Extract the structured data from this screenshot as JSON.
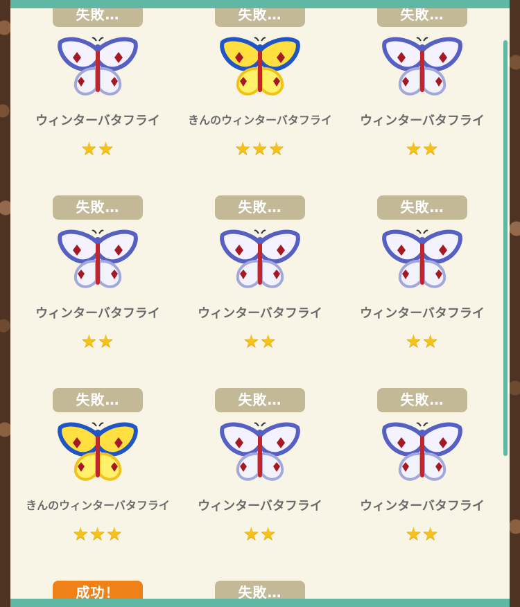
{
  "colors": {
    "panel_bg": "#f8f4e6",
    "accent_bar": "#5fb7a4",
    "fail_badge": "#c3b996",
    "success_badge": "#f08018",
    "star": "#f5c21b",
    "name_text": "#6a6a6a"
  },
  "results": [
    {
      "status": "失敗…",
      "name": "ウィンターバタフライ",
      "stars": "★★",
      "variant": "silver"
    },
    {
      "status": "失敗…",
      "name": "きんのウィンターバタフライ",
      "stars": "★★★",
      "variant": "gold"
    },
    {
      "status": "失敗…",
      "name": "ウィンターバタフライ",
      "stars": "★★",
      "variant": "silver"
    },
    {
      "status": "失敗…",
      "name": "ウィンターバタフライ",
      "stars": "★★",
      "variant": "silver"
    },
    {
      "status": "失敗…",
      "name": "ウィンターバタフライ",
      "stars": "★★",
      "variant": "silver"
    },
    {
      "status": "失敗…",
      "name": "ウィンターバタフライ",
      "stars": "★★",
      "variant": "silver"
    },
    {
      "status": "失敗…",
      "name": "きんのウィンターバタフライ",
      "stars": "★★★",
      "variant": "gold"
    },
    {
      "status": "失敗…",
      "name": "ウィンターバタフライ",
      "stars": "★★",
      "variant": "silver"
    },
    {
      "status": "失敗…",
      "name": "ウィンターバタフライ",
      "stars": "★★",
      "variant": "silver"
    },
    {
      "status": "成功！",
      "name": "",
      "stars": "",
      "variant": "success"
    },
    {
      "status": "失敗…",
      "name": "",
      "stars": "",
      "variant": "none"
    }
  ]
}
